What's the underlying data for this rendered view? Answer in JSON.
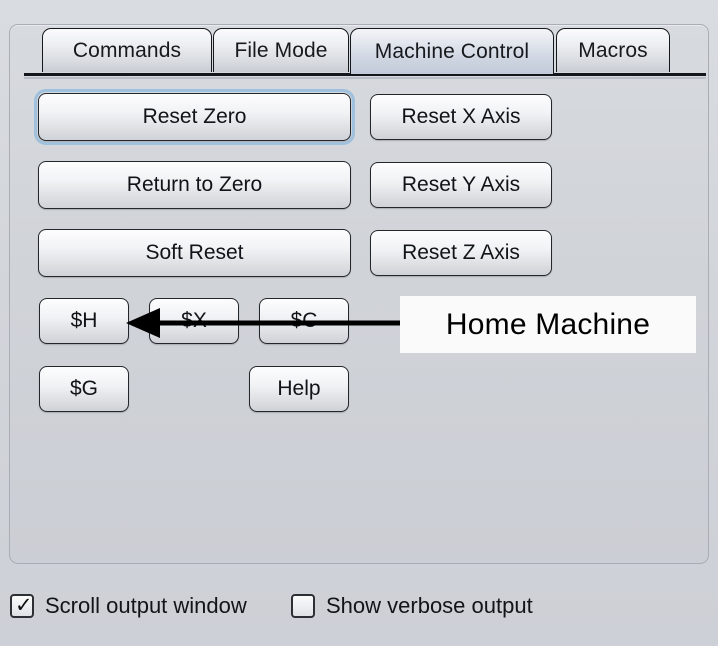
{
  "window": {
    "background_color": "#d4d7dc",
    "panel_color": "#d1d4d9"
  },
  "tabs": [
    {
      "label": "Commands",
      "active": false
    },
    {
      "label": "File Mode",
      "active": false
    },
    {
      "label": "Machine Control",
      "active": true
    },
    {
      "label": "Macros",
      "active": false
    }
  ],
  "machine_control": {
    "buttons": [
      {
        "label": "Reset Zero",
        "focused": true
      },
      {
        "label": "Return to Zero",
        "focused": false
      },
      {
        "label": "Soft Reset",
        "focused": false
      },
      {
        "label": "Reset X Axis",
        "focused": false
      },
      {
        "label": "Reset Y Axis",
        "focused": false
      },
      {
        "label": "Reset Z Axis",
        "focused": false
      },
      {
        "label": "$H",
        "focused": false
      },
      {
        "label": "$X",
        "focused": false
      },
      {
        "label": "$C",
        "focused": false
      },
      {
        "label": "$G",
        "focused": false
      },
      {
        "label": "Help",
        "focused": false
      }
    ]
  },
  "annotation": {
    "text": "Home Machine",
    "box_color": "#fafafa",
    "arrow_color": "#000000",
    "points_to": "$H"
  },
  "footer": {
    "checkboxes": [
      {
        "label": "Scroll output window",
        "checked": true,
        "tick": "✓"
      },
      {
        "label": "Show verbose output",
        "checked": false,
        "tick": ""
      }
    ]
  }
}
